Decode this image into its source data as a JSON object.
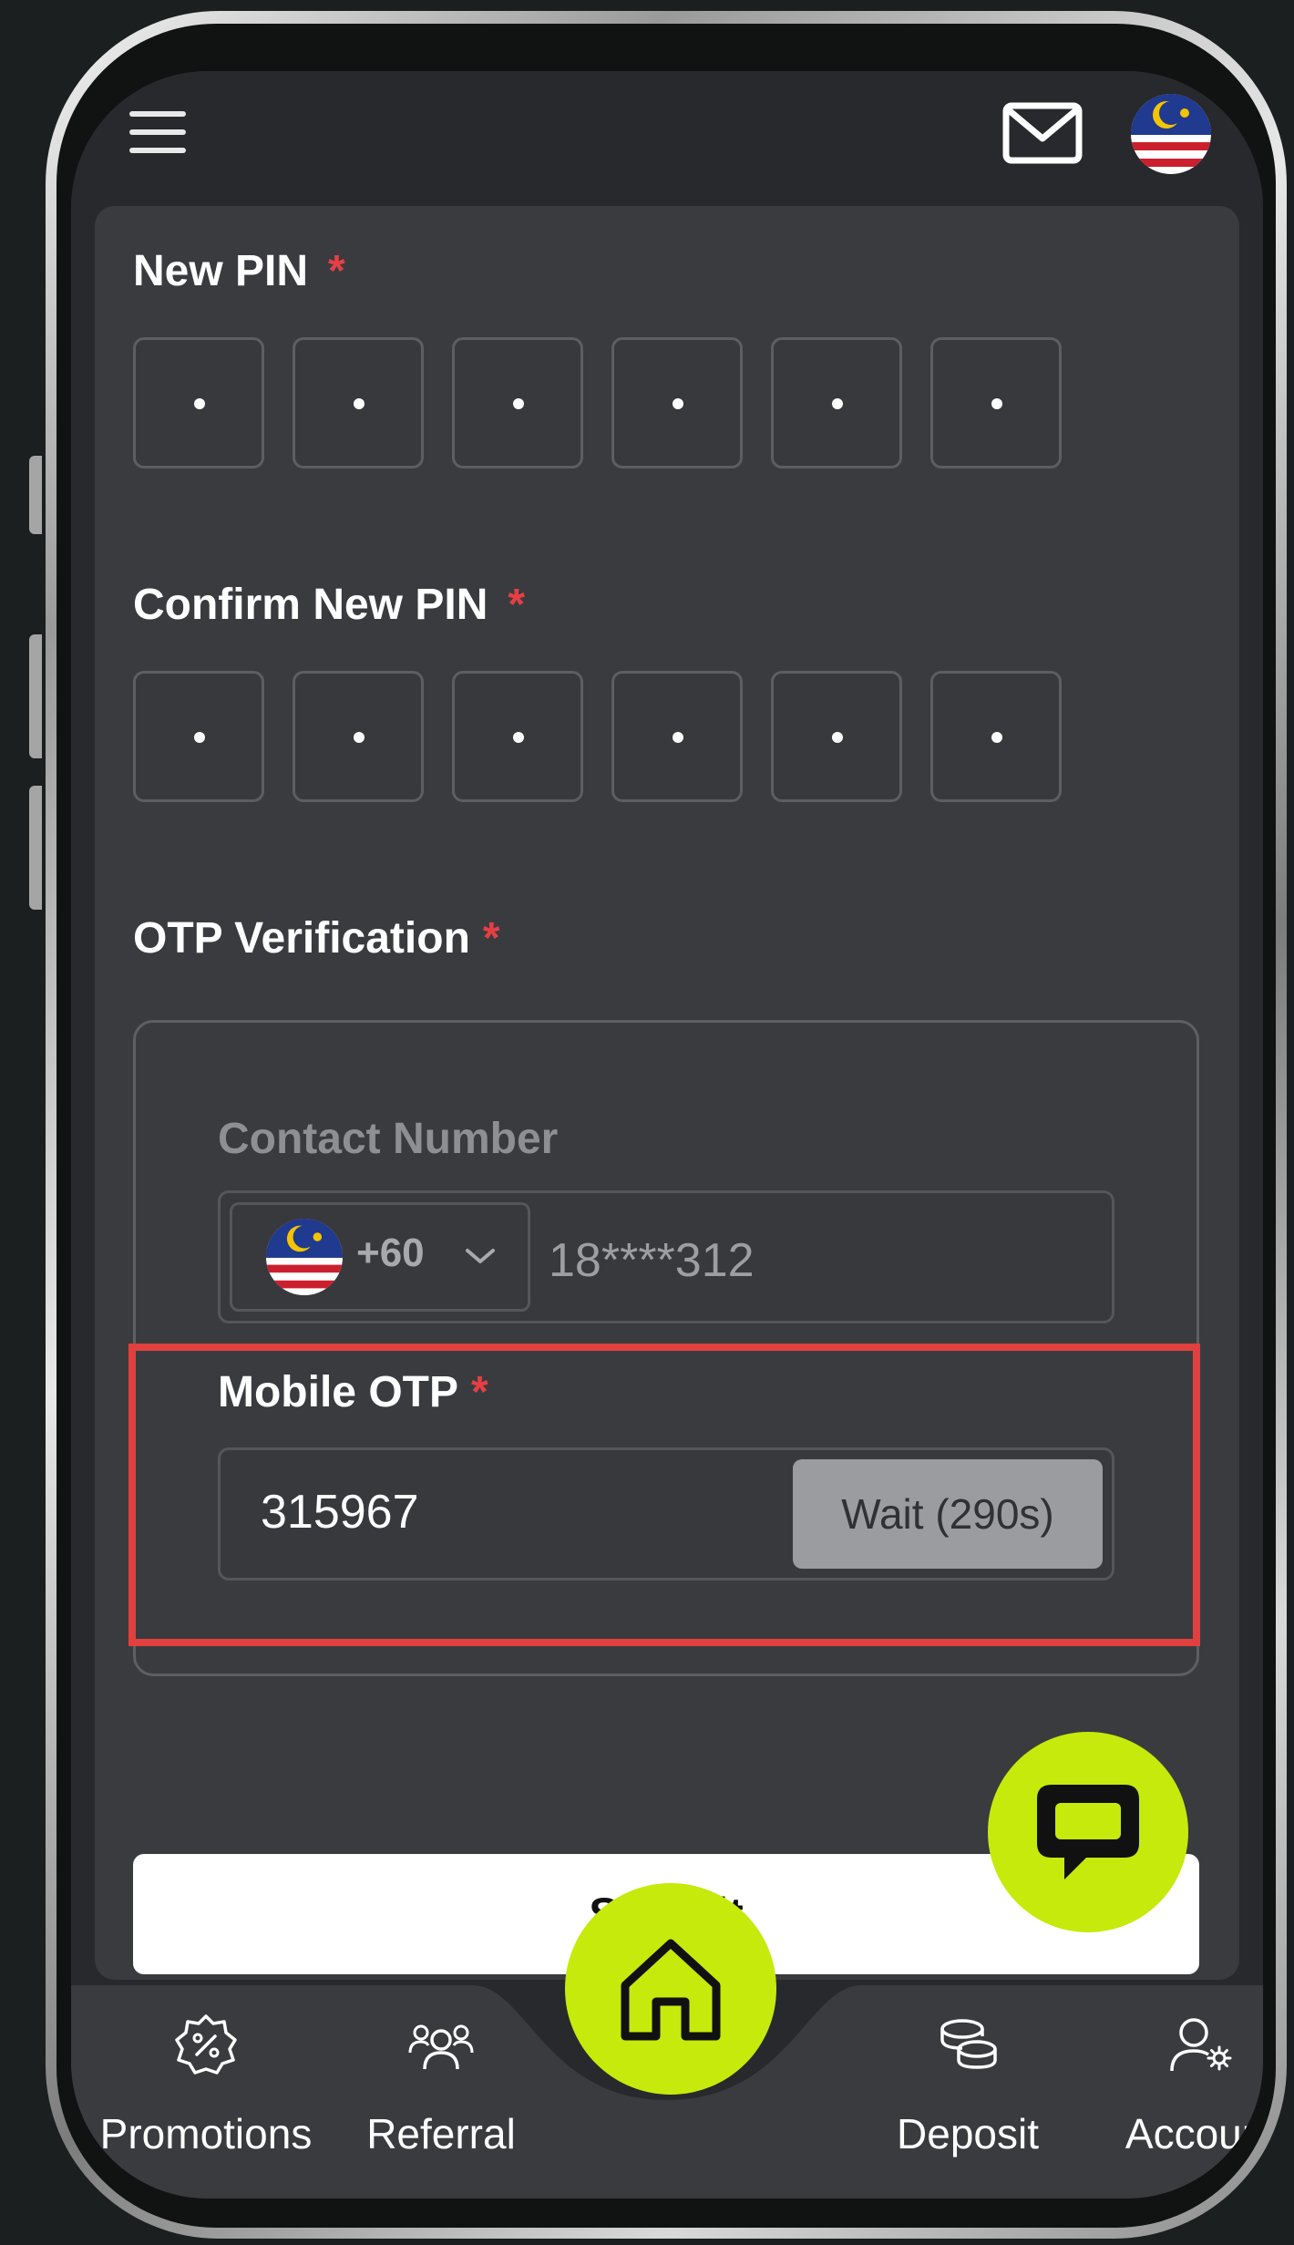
{
  "header": {
    "menu_icon": "hamburger-icon",
    "mail_icon": "mail-icon",
    "language_flag_icon": "malaysia-flag-icon"
  },
  "form": {
    "new_pin": {
      "label": "New PIN",
      "required_mark": "*",
      "masked_digits": 6
    },
    "confirm_new_pin": {
      "label": "Confirm New PIN",
      "required_mark": "*",
      "masked_digits": 6
    },
    "otp_verification": {
      "label": "OTP Verification",
      "required_mark": "*",
      "contact_number": {
        "label": "Contact Number",
        "country_flag_icon": "malaysia-flag-icon",
        "dial_code": "+60",
        "value": "18****312"
      },
      "mobile_otp": {
        "label": "Mobile OTP",
        "required_mark": "*",
        "value": "315967",
        "wait_button_label": "Wait (290s)"
      }
    },
    "submit_label": "Submit"
  },
  "chat_button_icon": "chat-bubble-icon",
  "bottom_nav": {
    "home_icon": "home-icon",
    "items": [
      {
        "label": "Promotions",
        "icon": "discount-badge-icon"
      },
      {
        "label": "Referral",
        "icon": "users-group-icon"
      },
      {
        "label": "Deposit",
        "icon": "coins-icon"
      },
      {
        "label": "Account",
        "icon": "user-settings-icon"
      }
    ]
  },
  "colors": {
    "accent": "#c6ea0b",
    "required": "#e53f45",
    "highlight_border": "#e1403f",
    "card_bg": "#3a3b3f",
    "header_bg": "#27292c"
  }
}
